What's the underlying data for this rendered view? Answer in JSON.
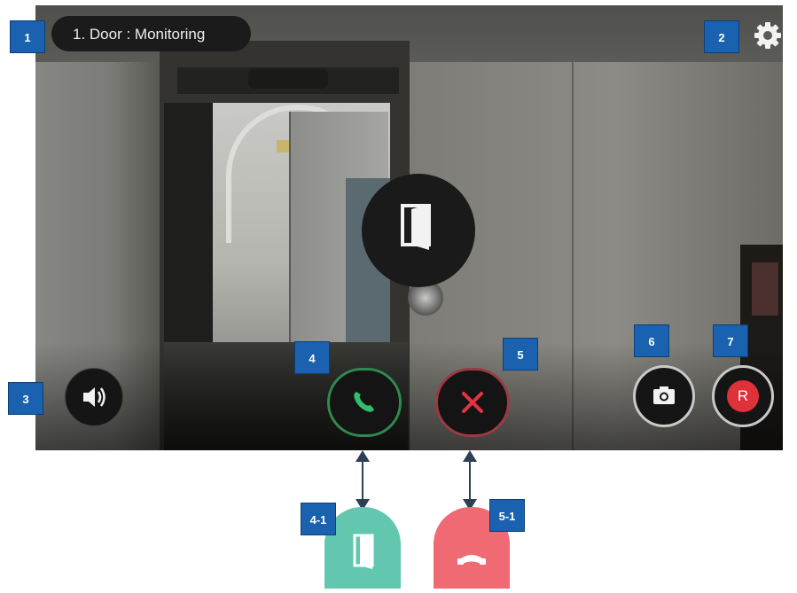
{
  "header": {
    "title": "1. Door : Monitoring"
  },
  "badges": {
    "b1": "1",
    "b2": "2",
    "b3": "3",
    "b4": "4",
    "b5": "5",
    "b6": "6",
    "b7": "7",
    "b41": "4-1",
    "b51": "5-1"
  },
  "buttons": {
    "record_label": "R"
  },
  "icons": {
    "settings": "gear-icon",
    "door_open": "door-open-icon",
    "speaker": "speaker-icon",
    "call": "phone-icon",
    "end": "close-icon",
    "snapshot": "camera-icon",
    "record": "record-icon",
    "door_alt": "door-icon",
    "hangup_alt": "hangup-icon"
  },
  "colors": {
    "badge": "#1a62b0",
    "call_ring": "#2f8a4f",
    "call_icon": "#2fbf6b",
    "end_ring": "#9c3a44",
    "end_icon": "#e5343f",
    "record": "#e0303a",
    "door_alt": "#63c7b0",
    "hangup_alt": "#ef6a72"
  }
}
